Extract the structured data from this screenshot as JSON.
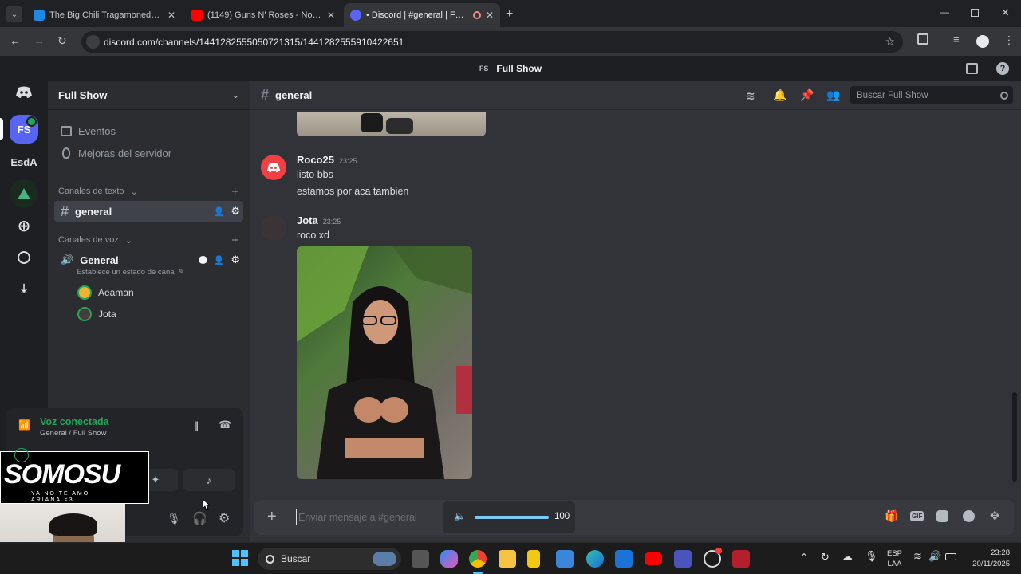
{
  "browser": {
    "tabs": [
      {
        "title": "The Big Chili Tragamonedas | 1x",
        "active": false,
        "favicon_color": "#1e88e5"
      },
      {
        "title": "(1149) Guns N' Roses - Novemb",
        "active": false,
        "favicon_color": "#ff0000"
      },
      {
        "title": "• Discord | #general | Full Sh",
        "active": true,
        "favicon_color": "#5865f2"
      }
    ],
    "url": "discord.com/channels/1441282555050721315/1441282555910422651"
  },
  "discord": {
    "window_title_badge": "FS",
    "window_title": "Full Show",
    "guilds": {
      "active_label": "FS",
      "second_label": "EsdA"
    },
    "server": {
      "name": "Full Show",
      "events_label": "Eventos",
      "boost_label": "Mejoras del servidor",
      "text_category": "Canales de texto",
      "text_channel": "general",
      "voice_category": "Canales de voz",
      "voice_channel": "General",
      "voice_status_hint": "Establece un estado de canal",
      "voice_users": [
        "Aeaman",
        "Jota"
      ]
    },
    "voice": {
      "status": "Voz conectada",
      "location": "General / Full Show"
    },
    "channel": {
      "name": "general",
      "search_placeholder": "Buscar Full Show"
    },
    "messages": [
      {
        "author": "Roco25",
        "time": "23:25",
        "lines": [
          "listo bbs",
          "estamos por aca tambien"
        ]
      },
      {
        "author": "Jota",
        "time": "23:25",
        "lines": [
          "roco xd"
        ]
      }
    ],
    "composer": {
      "placeholder": "Enviar mensaje a #general",
      "volume": "100"
    }
  },
  "overlay": {
    "logo_text": "SOMOSU",
    "subtitle": "YA NO TE AMO ARIANA <3"
  },
  "taskbar": {
    "search_label": "Buscar",
    "lang_top": "ESP",
    "lang_bottom": "LAA",
    "time": "23:28",
    "date": "20/11/2025"
  },
  "colors": {
    "discord_blurple": "#5865f2",
    "voice_green": "#23a55a",
    "mention_red": "#f23f43"
  }
}
